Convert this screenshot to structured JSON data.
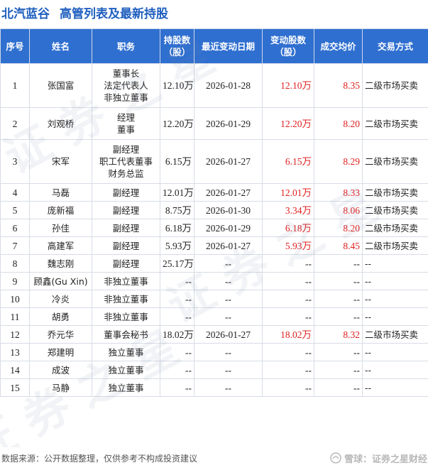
{
  "header": {
    "company": "北汽蓝谷",
    "title": "高管列表及最新持股"
  },
  "columns": [
    "序号",
    "姓名",
    "职务",
    "持股数\n（股）",
    "最近变动日期",
    "变动股数\n（股）",
    "成交均价",
    "交易方式"
  ],
  "rows": [
    {
      "no": "1",
      "name": "张国富",
      "duty": [
        "董事长",
        "法定代表人",
        "非独立董事"
      ],
      "hold": "12.10万",
      "date": "2026-01-28",
      "change": "12.10万",
      "price": "8.35",
      "method": "二级市场买卖"
    },
    {
      "no": "2",
      "name": "刘观桥",
      "duty": [
        "经理",
        "董事"
      ],
      "hold": "12.20万",
      "date": "2026-01-29",
      "change": "12.20万",
      "price": "8.20",
      "method": "二级市场买卖"
    },
    {
      "no": "3",
      "name": "宋军",
      "duty": [
        "副经理",
        "职工代表董事",
        "财务总监"
      ],
      "hold": "6.15万",
      "date": "2026-01-27",
      "change": "6.15万",
      "price": "8.29",
      "method": "二级市场买卖"
    },
    {
      "no": "4",
      "name": "马磊",
      "duty": [
        "副经理"
      ],
      "hold": "12.01万",
      "date": "2026-01-27",
      "change": "12.01万",
      "price": "8.33",
      "method": "二级市场买卖"
    },
    {
      "no": "5",
      "name": "庞新福",
      "duty": [
        "副经理"
      ],
      "hold": "8.75万",
      "date": "2026-01-30",
      "change": "3.34万",
      "price": "8.06",
      "method": "二级市场买卖"
    },
    {
      "no": "6",
      "name": "孙佳",
      "duty": [
        "副经理"
      ],
      "hold": "6.18万",
      "date": "2026-01-29",
      "change": "6.18万",
      "price": "8.20",
      "method": "二级市场买卖"
    },
    {
      "no": "7",
      "name": "高建军",
      "duty": [
        "副经理"
      ],
      "hold": "5.93万",
      "date": "2026-01-27",
      "change": "5.93万",
      "price": "8.45",
      "method": "二级市场买卖"
    },
    {
      "no": "8",
      "name": "魏志刚",
      "duty": [
        "副经理"
      ],
      "hold": "25.17万",
      "date": "--",
      "change": "--",
      "price": "--",
      "method": "--"
    },
    {
      "no": "9",
      "name": "顾鑫(Gu Xin)",
      "duty": [
        "非独立董事"
      ],
      "hold": "--",
      "date": "--",
      "change": "--",
      "price": "--",
      "method": "--"
    },
    {
      "no": "10",
      "name": "冷炎",
      "duty": [
        "非独立董事"
      ],
      "hold": "--",
      "date": "--",
      "change": "--",
      "price": "--",
      "method": "--"
    },
    {
      "no": "11",
      "name": "胡勇",
      "duty": [
        "非独立董事"
      ],
      "hold": "--",
      "date": "--",
      "change": "--",
      "price": "--",
      "method": "--"
    },
    {
      "no": "12",
      "name": "乔元华",
      "duty": [
        "董事会秘书"
      ],
      "hold": "18.02万",
      "date": "2026-01-27",
      "change": "18.02万",
      "price": "8.32",
      "method": "二级市场买卖"
    },
    {
      "no": "13",
      "name": "郑建明",
      "duty": [
        "独立董事"
      ],
      "hold": "--",
      "date": "--",
      "change": "--",
      "price": "--",
      "method": "--"
    },
    {
      "no": "14",
      "name": "成波",
      "duty": [
        "独立董事"
      ],
      "hold": "--",
      "date": "--",
      "change": "--",
      "price": "--",
      "method": "--"
    },
    {
      "no": "15",
      "name": "马静",
      "duty": [
        "独立董事"
      ],
      "hold": "--",
      "date": "--",
      "change": "--",
      "price": "--",
      "method": "--"
    }
  ],
  "footer": {
    "source": "数据来源：公开数据整理，仅供参考不构成投资建议",
    "brand": "雪球：证券之星财经"
  },
  "colors": {
    "header_bg": "#2f6fd0",
    "title": "#1f5fbf",
    "positive": "#e02020"
  }
}
